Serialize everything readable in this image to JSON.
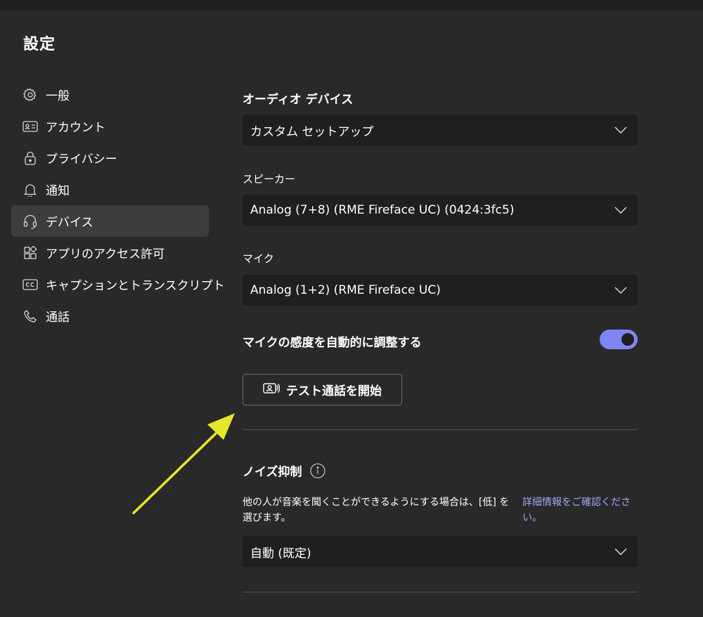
{
  "page": {
    "title": "設定"
  },
  "sidebar": {
    "items": [
      {
        "label": "一般",
        "icon": "gear-icon",
        "active": false
      },
      {
        "label": "アカウント",
        "icon": "id-card-icon",
        "active": false
      },
      {
        "label": "プライバシー",
        "icon": "lock-icon",
        "active": false
      },
      {
        "label": "通知",
        "icon": "bell-icon",
        "active": false
      },
      {
        "label": "デバイス",
        "icon": "headset-icon",
        "active": true
      },
      {
        "label": "アプリのアクセス許可",
        "icon": "apps-icon",
        "active": false
      },
      {
        "label": "キャプションとトランスクリプト",
        "icon": "cc-icon",
        "active": false
      },
      {
        "label": "通話",
        "icon": "phone-icon",
        "active": false
      }
    ]
  },
  "devices": {
    "audio_title": "オーディオ デバイス",
    "audio_value": "カスタム セットアップ",
    "speaker_label": "スピーカー",
    "speaker_value": "Analog (7+8) (RME Fireface UC) (0424:3fc5)",
    "mic_label": "マイク",
    "mic_value": "Analog (1+2) (RME Fireface UC)",
    "auto_adjust_label": "マイクの感度を自動的に調整する",
    "auto_adjust_on": true,
    "test_call_label": "テスト通話を開始",
    "noise_title": "ノイズ抑制",
    "noise_desc": "他の人が音楽を聞くことができるようにする場合は、[低] を選びます。",
    "learn_more": "詳細情報をご確認ください。",
    "noise_value": "自動 (既定)"
  },
  "colors": {
    "background": "#292929",
    "panel": "#1f1f1f",
    "accent": "#7f85f5",
    "link": "#a1a5f7",
    "annotation_arrow": "#e6e62a"
  }
}
